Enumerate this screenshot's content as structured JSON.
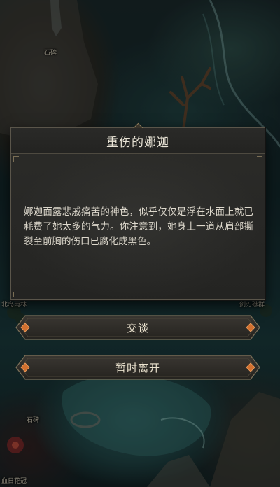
{
  "map": {
    "locations": [
      {
        "id": "stone-statue-top",
        "name": "石碑"
      },
      {
        "id": "north-forest",
        "name": "北岛雨林"
      },
      {
        "id": "reef-right",
        "name": "剑刃礁群"
      },
      {
        "id": "stone-statue-bottom",
        "name": "石碑"
      },
      {
        "id": "bloodsun-flower",
        "name": "血日花冠"
      }
    ]
  },
  "dialog": {
    "title": "重伤的娜迦",
    "body": "娜迦面露悲戚痛苦的神色，似乎仅仅是浮在水面上就已耗费了她太多的气力。你注意到，她身上一道从肩部撕裂至前胸的伤口已腐化成黑色。"
  },
  "options": [
    {
      "id": "talk",
      "label": "交谈"
    },
    {
      "id": "leave",
      "label": "暂时离开"
    }
  ],
  "colors": {
    "panel_bg": "#282826",
    "panel_border": "#5a554a",
    "button_accent": "#d2702f",
    "text_primary": "#e9e4d6"
  }
}
